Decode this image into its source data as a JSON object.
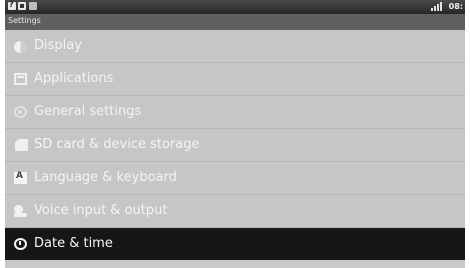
{
  "status_bar": {
    "time": "08:",
    "notification_icons": [
      "question-icon",
      "square-icon",
      "app-icon"
    ],
    "signal_icon": "signal-bars-icon"
  },
  "title_bar": {
    "title": "Settings"
  },
  "settings_list": {
    "items": [
      {
        "label": "Display",
        "icon": "display-icon",
        "selected": false
      },
      {
        "label": "Applications",
        "icon": "applications-icon",
        "selected": false
      },
      {
        "label": "General settings",
        "icon": "general-settings-icon",
        "selected": false
      },
      {
        "label": "SD card & device storage",
        "icon": "sd-card-icon",
        "selected": false
      },
      {
        "label": "Language & keyboard",
        "icon": "language-icon",
        "selected": false
      },
      {
        "label": "Voice input & output",
        "icon": "voice-icon",
        "selected": false
      },
      {
        "label": "Date & time",
        "icon": "clock-icon",
        "selected": true
      }
    ]
  },
  "colors": {
    "list_background": "#c6c6c6",
    "selected_background": "#161616",
    "status_bar": "#333333",
    "title_bar": "#5f5f5f"
  }
}
